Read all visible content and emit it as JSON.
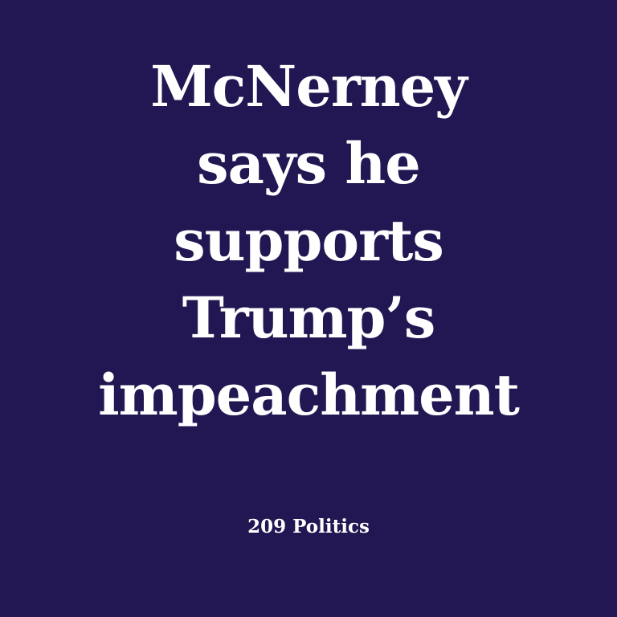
{
  "headline": {
    "lines": [
      "McNerney",
      "says he",
      "supports",
      "Trump’s",
      "impeachment"
    ]
  },
  "source": "209 Politics",
  "colors": {
    "background": "#221752",
    "text": "#ffffff"
  }
}
